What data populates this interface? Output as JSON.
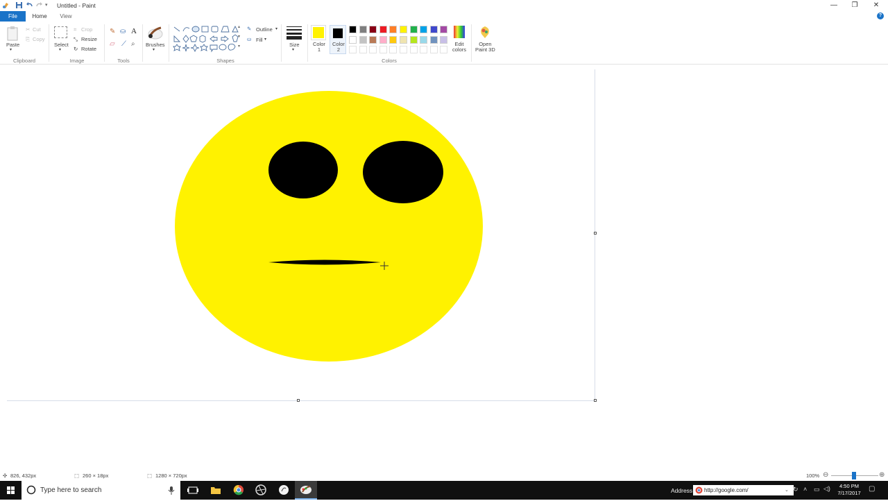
{
  "window": {
    "title": "Untitled - Paint"
  },
  "tabs": {
    "file": "File",
    "home": "Home",
    "view": "View"
  },
  "clipboard": {
    "paste": "Paste",
    "cut": "Cut",
    "copy": "Copy",
    "group": "Clipboard"
  },
  "image": {
    "select": "Select",
    "crop": "Crop",
    "resize": "Resize",
    "rotate": "Rotate",
    "group": "Image"
  },
  "tools": {
    "group": "Tools",
    "text_tool_glyph": "A"
  },
  "brushes": {
    "label": "Brushes"
  },
  "shapes": {
    "group": "Shapes",
    "outline": "Outline",
    "fill": "Fill"
  },
  "size": {
    "label": "Size"
  },
  "colors": {
    "group": "Colors",
    "color1_label": "Color\n1",
    "color2_label": "Color\n2",
    "color1": "#FFF200",
    "color2": "#000000",
    "edit": "Edit\ncolors",
    "paint3d": "Open\nPaint 3D",
    "palette_row1": [
      "#000000",
      "#7F7F7F",
      "#880015",
      "#ED1C24",
      "#FF7F27",
      "#FFF200",
      "#22B14C",
      "#00A2E8",
      "#3F48CC",
      "#A349A4"
    ],
    "palette_row2": [
      "#FFFFFF",
      "#C3C3C3",
      "#B97A57",
      "#FFAEC9",
      "#FFC90E",
      "#EFE4B0",
      "#B5E61D",
      "#99D9EA",
      "#7092BE",
      "#C8BFE7"
    ]
  },
  "drawing": {
    "face_color": "#FFF200",
    "feature_color": "#000000"
  },
  "status": {
    "cursor_pos": "826, 432px",
    "selection_size": "260 × 18px",
    "canvas_size": "1280 × 720px",
    "zoom": "100%"
  },
  "taskbar": {
    "search_placeholder": "Type here to search",
    "address_label": "Address",
    "address_value": "http://google.com/",
    "time": "4:50 PM",
    "date": "7/17/2017"
  }
}
